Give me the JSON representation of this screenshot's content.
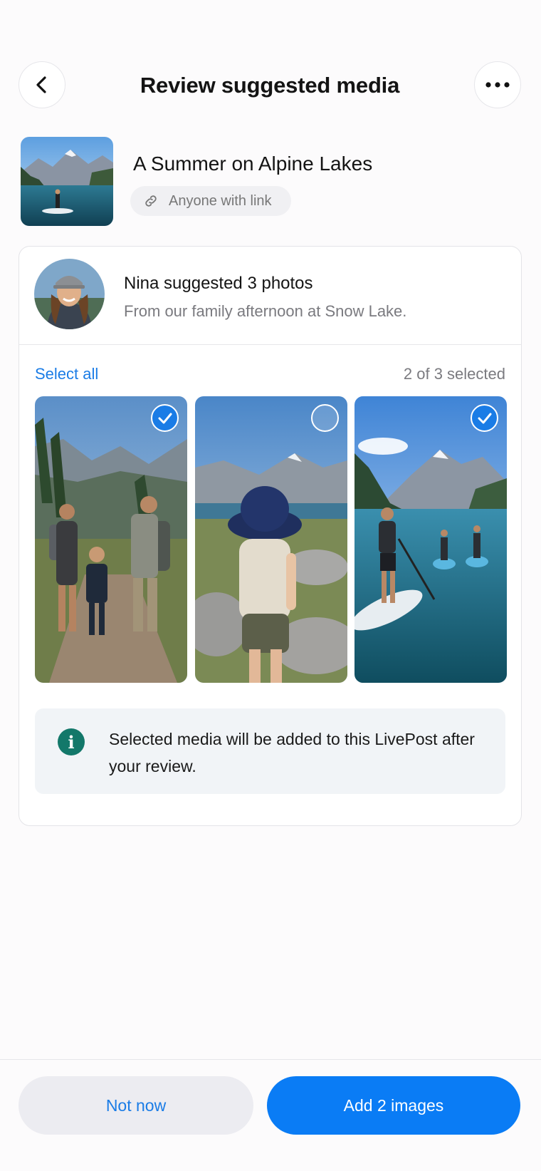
{
  "header": {
    "title": "Review suggested media",
    "back_icon": "chevron-left-icon",
    "more_icon": "more-horizontal-icon"
  },
  "post": {
    "title": "A Summer on Alpine Lakes",
    "share_label": "Anyone with link",
    "share_icon": "link-icon"
  },
  "suggestion": {
    "name_line": "Nina suggested 3 photos",
    "note": "From our family afternoon at Snow Lake.",
    "select_all_label": "Select all",
    "selected_count": "2 of 3 selected",
    "photos": [
      {
        "subject": "family hiking on mountain trail",
        "selected": true
      },
      {
        "subject": "child in bucket hat by alpine lake",
        "selected": false
      },
      {
        "subject": "paddleboarders on alpine lake",
        "selected": true
      }
    ],
    "info_text": "Selected media will be added to this LivePost after your review."
  },
  "footer": {
    "secondary_label": "Not now",
    "primary_label": "Add 2 images"
  },
  "colors": {
    "accent": "#0a7cf5",
    "link": "#1a7ce6",
    "info_icon": "#13786a"
  }
}
